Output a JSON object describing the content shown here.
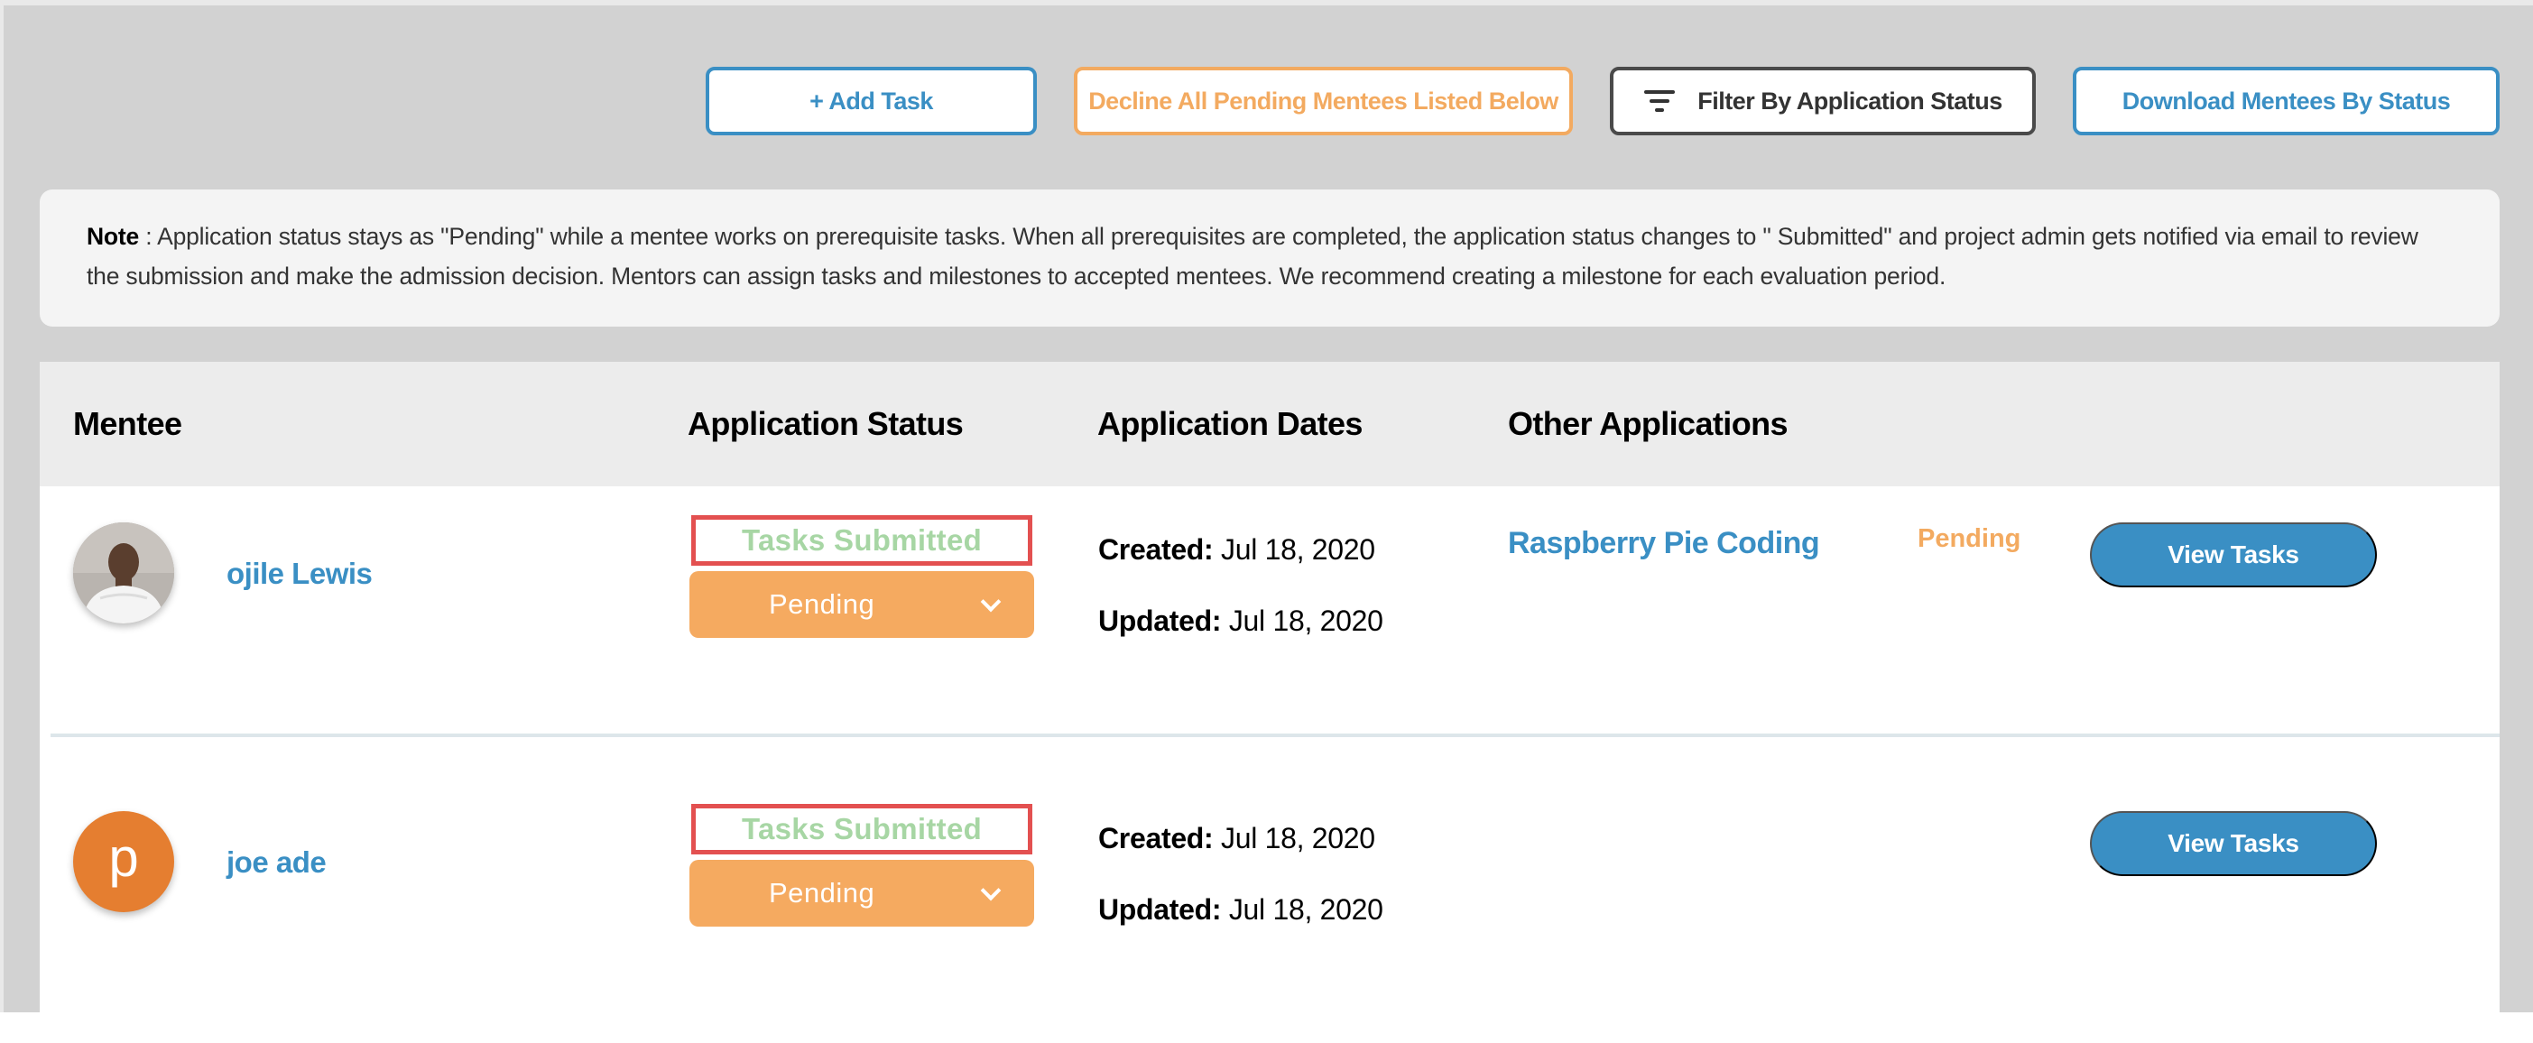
{
  "toolbar": {
    "add_task_label": "+ Add Task",
    "decline_all_label": "Decline All Pending Mentees Listed Below",
    "filter_label": "Filter By Application Status",
    "download_label": "Download Mentees By Status"
  },
  "note": {
    "prefix": "Note",
    "text": " : Application status stays as \"Pending\" while a mentee works on prerequisite tasks. When all prerequisites are completed, the application status changes to \" Submitted\" and project admin gets notified via email to review the submission and make the admission decision. Mentors can assign tasks and milestones to accepted mentees. We recommend creating a milestone for each evaluation period."
  },
  "table": {
    "headers": {
      "mentee": "Mentee",
      "status": "Application Status",
      "dates": "Application Dates",
      "other": "Other Applications"
    },
    "rows": [
      {
        "name": "ojile Lewis",
        "avatar_letter": "",
        "tasks_label": "Tasks Submitted",
        "status_value": "Pending",
        "created_label": "Created:",
        "created_value": " Jul 18, 2020",
        "updated_label": "Updated:",
        "updated_value": " Jul 18, 2020",
        "other_app_name": "Raspberry Pie Coding",
        "other_app_status": "Pending",
        "view_label": "View Tasks"
      },
      {
        "name": "joe ade",
        "avatar_letter": "p",
        "tasks_label": "Tasks Submitted",
        "status_value": "Pending",
        "created_label": "Created:",
        "created_value": " Jul 18, 2020",
        "updated_label": "Updated:",
        "updated_value": " Jul 18, 2020",
        "other_app_name": "",
        "other_app_status": "",
        "view_label": "View Tasks"
      }
    ]
  },
  "colors": {
    "primary_blue": "#3a8fc4",
    "pending_orange": "#f5aa60",
    "submitted_green": "#a7d6a4",
    "highlight_red": "#e35050",
    "avatar_orange": "#e57e30"
  }
}
